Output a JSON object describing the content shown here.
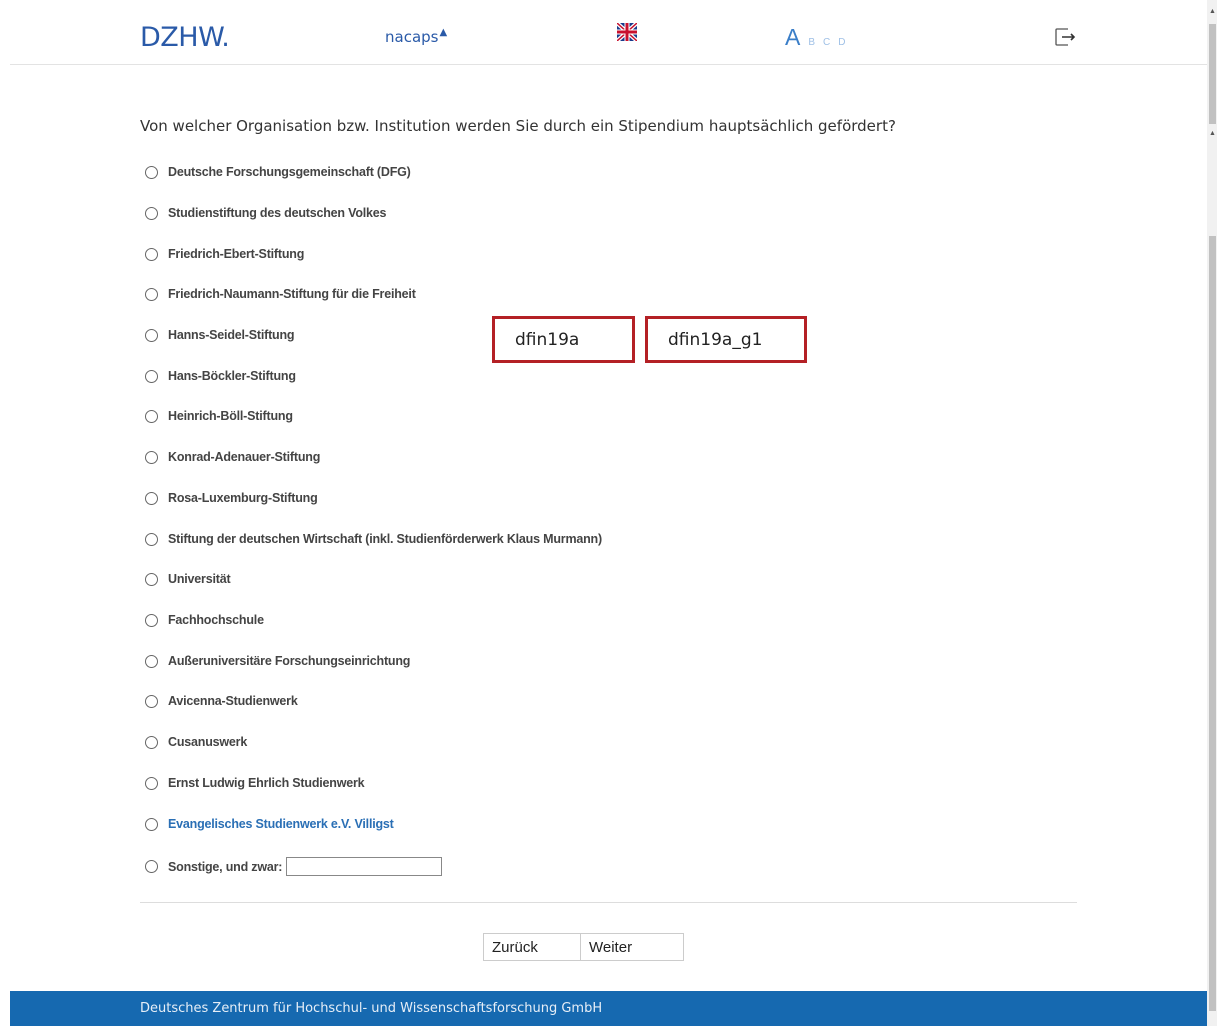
{
  "header": {
    "logo_dzhw": "DZHW.",
    "logo_nacaps": "nacaps",
    "abcd_current": "A",
    "abcd_others": [
      "B",
      "C",
      "D"
    ]
  },
  "question": {
    "text": "Von welcher Organisation bzw. Institution werden Sie durch ein Stipendium hauptsächlich gefördert?",
    "options": [
      "Deutsche Forschungsgemeinschaft (DFG)",
      "Studienstiftung des deutschen Volkes",
      "Friedrich-Ebert-Stiftung",
      "Friedrich-Naumann-Stiftung für die Freiheit",
      "Hanns-Seidel-Stiftung",
      "Hans-Böckler-Stiftung",
      "Heinrich-Böll-Stiftung",
      "Konrad-Adenauer-Stiftung",
      "Rosa-Luxemburg-Stiftung",
      "Stiftung der deutschen Wirtschaft (inkl. Studienförderwerk Klaus Murmann)",
      "Universität",
      "Fachhochschule",
      "Außeruniversitäre Forschungseinrichtung",
      "Avicenna-Studienwerk",
      "Cusanuswerk",
      "Ernst Ludwig Ehrlich Studienwerk",
      "Evangelisches Studienwerk e.V. Villigst",
      "Sonstige, und zwar:"
    ],
    "other_value": ""
  },
  "annotations": {
    "var1": "dfin19a",
    "var2": "dfin19a_g1"
  },
  "nav": {
    "back": "Zurück",
    "next": "Weiter"
  },
  "footer": {
    "text": "Deutsches Zentrum für Hochschul- und Wissenschaftsforschung GmbH"
  },
  "colors": {
    "brand_blue": "#1669b0",
    "annotation_red": "#b42025"
  }
}
